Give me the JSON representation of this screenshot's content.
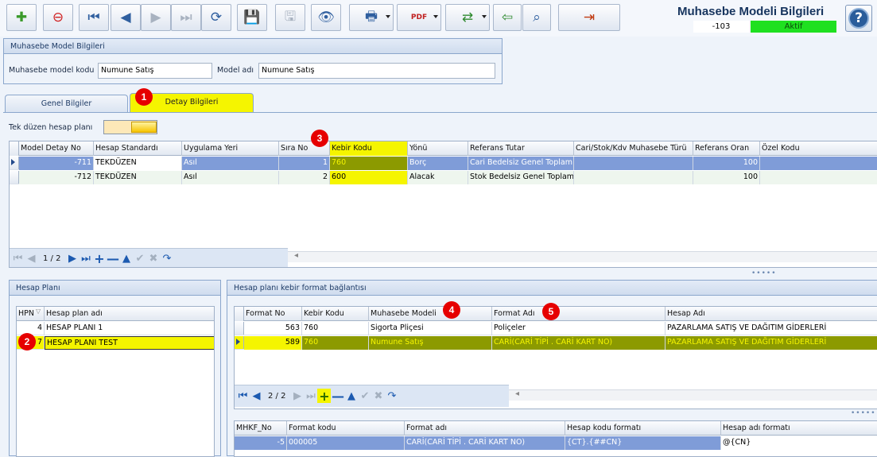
{
  "window": {
    "title": "Muhasebe Modeli Bilgileri",
    "record_id": "-103",
    "status": "Aktif",
    "help_glyph": "?"
  },
  "toolbar": {
    "buttons": [
      {
        "icon": "new-record-icon",
        "glyph": "✚"
      },
      {
        "icon": "delete-record-icon",
        "glyph": "⊖"
      },
      {
        "icon": "first-record-icon",
        "glyph": "⏮"
      },
      {
        "icon": "previous-record-icon",
        "glyph": "◀"
      },
      {
        "icon": "next-record-icon",
        "glyph": "▶"
      },
      {
        "icon": "last-record-icon",
        "glyph": "⏭"
      },
      {
        "icon": "refresh-icon",
        "glyph": "⟳"
      },
      {
        "icon": "save-icon",
        "glyph": "💾"
      },
      {
        "icon": "save-close-icon",
        "glyph": "🖫"
      },
      {
        "icon": "preview-icon",
        "glyph": "👁"
      },
      {
        "icon": "print-icon",
        "glyph": "🖶"
      },
      {
        "icon": "pdf-export-icon",
        "glyph": "PDF"
      },
      {
        "icon": "export-icon",
        "glyph": "⇄"
      },
      {
        "icon": "import-icon",
        "glyph": "⇦"
      },
      {
        "icon": "search-icon",
        "glyph": "⌕"
      },
      {
        "icon": "exit-door-icon",
        "glyph": "⇥"
      }
    ]
  },
  "model_group": {
    "title": "Muhasebe Model Bilgileri",
    "code_label": "Muhasebe model kodu",
    "code_value": "Numune Satış",
    "name_label": "Model adı",
    "name_value": "Numune Satış"
  },
  "tabs": [
    {
      "label": "Genel Bilgiler",
      "active": false
    },
    {
      "label": "Detay Bilgileri",
      "active": true
    }
  ],
  "detail": {
    "toggle_label": "Tek düzen hesap planı",
    "columns": [
      "Model Detay No",
      "Hesap Standardı",
      "Uygulama Yeri",
      "Sıra No",
      "Kebir Kodu",
      "Yönü",
      "Referans Tutar",
      "Cari/Stok/Kdv Muhasebe Türü",
      "Referans Oran",
      "Özel Kodu"
    ],
    "rows": [
      {
        "no": "-711",
        "std": "TEKDÜZEN",
        "yer": "Asıl",
        "sira": "1",
        "kebir": "760",
        "yon": "Borç",
        "ref": "Cari Bedelsiz Genel Toplam",
        "tur": "",
        "oran": "100",
        "ozel": ""
      },
      {
        "no": "-712",
        "std": "TEKDÜZEN",
        "yer": "Asıl",
        "sira": "2",
        "kebir": "600",
        "yon": "Alacak",
        "ref": "Stok Bedelsiz Genel Toplam",
        "tur": "",
        "oran": "100",
        "ozel": ""
      }
    ],
    "page": "1 / 2"
  },
  "hesap_plani": {
    "title": "Hesap Planı",
    "columns": [
      "HPN",
      "Hesap plan adı"
    ],
    "rows": [
      {
        "hpn": "4",
        "name": "HESAP PLANI 1"
      },
      {
        "hpn": "7",
        "name": "HESAP PLANI TEST"
      }
    ]
  },
  "kebir_format": {
    "title": "Hesap planı kebir format bağlantısı",
    "columns": [
      "Format No",
      "Kebir Kodu",
      "Muhasebe Modeli",
      "Format Adı",
      "Hesap Adı"
    ],
    "rows": [
      {
        "no": "563",
        "kebir": "760",
        "model": "Sigorta Pliçesi",
        "format": "Poliçeler",
        "hesap": "PAZARLAMA SATIŞ VE DAĞITIM GİDERLERİ"
      },
      {
        "no": "589",
        "kebir": "760",
        "model": "Numune Satış",
        "format": "CARİ(CARİ TİPİ . CARİ KART NO)",
        "hesap": "PAZARLAMA SATIŞ VE DAĞITIM GİDERLERİ"
      }
    ],
    "page": "2 / 2"
  },
  "mhkf": {
    "columns": [
      "MHKF_No",
      "Format kodu",
      "Format adı",
      "Hesap kodu formatı",
      "Hesap adı formatı"
    ],
    "rows": [
      {
        "no": "-5",
        "kod": "000005",
        "ad": "CARİ(CARİ TİPİ . CARİ KART NO)",
        "hkod": "{CT}.{##CN}",
        "had": "@{CN}"
      }
    ]
  },
  "badges": [
    "1",
    "2",
    "3",
    "4",
    "5"
  ],
  "colors": {
    "highlight": "#f5f500",
    "selected_dark": "#8c9a00",
    "selected_blue": "#7f9cd8",
    "active_green": "#1fe020",
    "badge_red": "#e60000"
  }
}
